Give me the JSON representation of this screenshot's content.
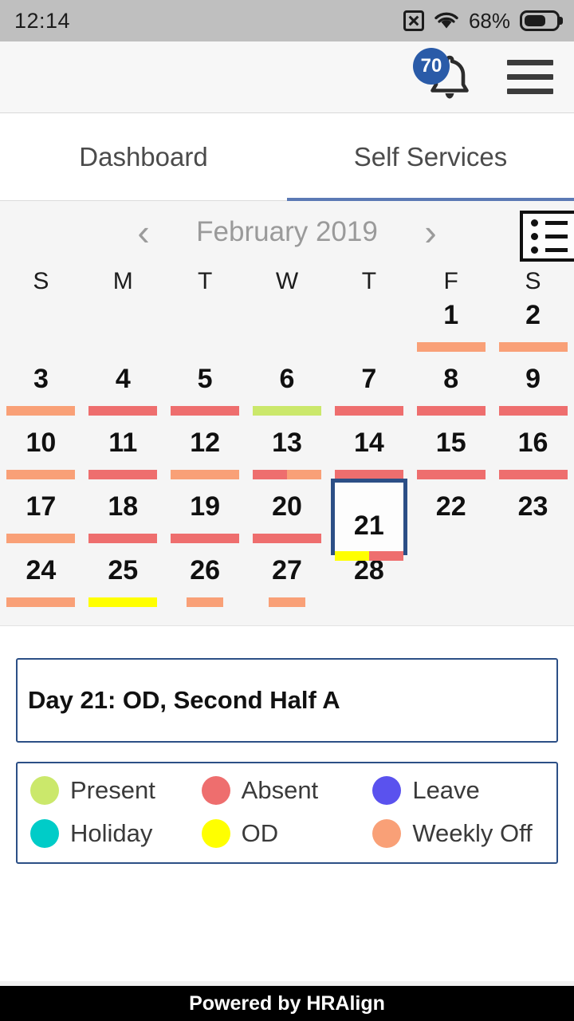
{
  "status_bar": {
    "time": "12:14",
    "battery_percent": "68%",
    "icons": [
      "no-sim-icon",
      "wifi-icon",
      "battery-icon"
    ]
  },
  "app_bar": {
    "notification_count": "70",
    "bell_icon": "bell-icon",
    "menu_icon": "hamburger-menu-icon"
  },
  "tabs": [
    {
      "label": "Dashboard",
      "active": false
    },
    {
      "label": "Self Services",
      "active": true
    }
  ],
  "calendar": {
    "month_label": "February 2019",
    "prev_icon": "‹",
    "next_icon": "›",
    "list_view_icon": "list-view-icon",
    "weekdays": [
      "S",
      "M",
      "T",
      "W",
      "T",
      "F",
      "S"
    ],
    "leading_blanks": 5,
    "days": [
      {
        "num": "1",
        "segments": [
          "weekly_off"
        ],
        "width": "full"
      },
      {
        "num": "2",
        "segments": [
          "weekly_off"
        ],
        "width": "full"
      },
      {
        "num": "3",
        "segments": [
          "weekly_off"
        ],
        "width": "full"
      },
      {
        "num": "4",
        "segments": [
          "absent"
        ],
        "width": "full"
      },
      {
        "num": "5",
        "segments": [
          "absent"
        ],
        "width": "full"
      },
      {
        "num": "6",
        "segments": [
          "present"
        ],
        "width": "full"
      },
      {
        "num": "7",
        "segments": [
          "absent"
        ],
        "width": "full"
      },
      {
        "num": "8",
        "segments": [
          "absent"
        ],
        "width": "full"
      },
      {
        "num": "9",
        "segments": [
          "absent"
        ],
        "width": "full"
      },
      {
        "num": "10",
        "segments": [
          "weekly_off"
        ],
        "width": "full"
      },
      {
        "num": "11",
        "segments": [
          "absent"
        ],
        "width": "full"
      },
      {
        "num": "12",
        "segments": [
          "weekly_off"
        ],
        "width": "full"
      },
      {
        "num": "13",
        "segments": [
          "absent",
          "weekly_off"
        ],
        "width": "full"
      },
      {
        "num": "14",
        "segments": [
          "absent"
        ],
        "width": "full"
      },
      {
        "num": "15",
        "segments": [
          "absent"
        ],
        "width": "full"
      },
      {
        "num": "16",
        "segments": [
          "absent"
        ],
        "width": "full"
      },
      {
        "num": "17",
        "segments": [
          "weekly_off"
        ],
        "width": "full"
      },
      {
        "num": "18",
        "segments": [
          "absent"
        ],
        "width": "full"
      },
      {
        "num": "19",
        "segments": [
          "absent"
        ],
        "width": "full"
      },
      {
        "num": "20",
        "segments": [
          "absent"
        ],
        "width": "full"
      },
      {
        "num": "21",
        "segments": [
          "od",
          "absent"
        ],
        "width": "full",
        "selected": true
      },
      {
        "num": "22",
        "segments": [],
        "width": "full"
      },
      {
        "num": "23",
        "segments": [],
        "width": "full"
      },
      {
        "num": "24",
        "segments": [
          "weekly_off"
        ],
        "width": "full"
      },
      {
        "num": "25",
        "segments": [
          "od"
        ],
        "width": "full"
      },
      {
        "num": "26",
        "segments": [
          "weekly_off"
        ],
        "width": "half"
      },
      {
        "num": "27",
        "segments": [
          "weekly_off"
        ],
        "width": "half"
      },
      {
        "num": "28",
        "segments": [],
        "width": "full"
      }
    ]
  },
  "detail": {
    "text": "Day 21: OD, Second Half A"
  },
  "legend": {
    "items": [
      {
        "label": "Present",
        "key": "present"
      },
      {
        "label": "Absent",
        "key": "absent"
      },
      {
        "label": "Leave",
        "key": "leave"
      },
      {
        "label": "Holiday",
        "key": "holiday"
      },
      {
        "label": "OD",
        "key": "od"
      },
      {
        "label": "Weekly Off",
        "key": "weekly_off"
      }
    ]
  },
  "colors": {
    "present": "#cbe86b",
    "absent": "#ee6e6e",
    "leave": "#5a52ee",
    "holiday": "#00ccc8",
    "od": "#ffff00",
    "weekly_off": "#f9a077",
    "accent_blue": "#2c4f86",
    "tab_underline": "#5b79b4",
    "badge_blue": "#2a5ba8"
  },
  "footer": {
    "text": "Powered by HRAlign"
  }
}
